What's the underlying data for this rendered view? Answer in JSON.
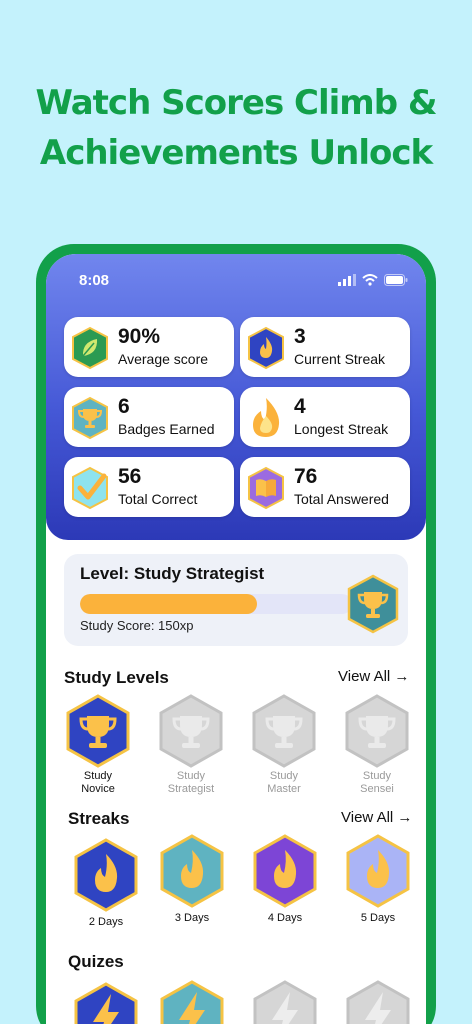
{
  "headline": {
    "line1": "Watch Scores Climb &",
    "line2": "Achievements Unlock"
  },
  "colors": {
    "brand_green": "#12a04a",
    "background": "#c4f2fc",
    "header_top": "#7186ee",
    "header_bottom": "#2c39b7",
    "progress": "#fbb23b"
  },
  "status_bar": {
    "time": "8:08"
  },
  "stats": [
    {
      "value": "90%",
      "label": "Average score",
      "icon": "leaf-icon"
    },
    {
      "value": "3",
      "label": "Current Streak",
      "icon": "flame-icon"
    },
    {
      "value": "6",
      "label": "Badges Earned",
      "icon": "trophy-icon"
    },
    {
      "value": "4",
      "label": "Longest Streak",
      "icon": "flame-icon"
    },
    {
      "value": "56",
      "label": "Total Correct",
      "icon": "checkmark-icon"
    },
    {
      "value": "76",
      "label": "Total Answered",
      "icon": "book-icon"
    }
  ],
  "level": {
    "title": "Level: Study Strategist",
    "score": "Study Score: 150xp",
    "progress": 0.65
  },
  "study_levels": {
    "title": "Study Levels",
    "view_all": "View All →",
    "items": [
      {
        "line1": "Study",
        "line2": "Novice",
        "unlocked": true
      },
      {
        "line1": "Study",
        "line2": "Strategist",
        "unlocked": false
      },
      {
        "line1": "Study",
        "line2": "Master",
        "unlocked": false
      },
      {
        "line1": "Study",
        "line2": "Sensei",
        "unlocked": false
      }
    ]
  },
  "streaks": {
    "title": "Streaks",
    "view_all": "View All →",
    "items": [
      {
        "label": "2 Days",
        "color": "#2f44c2"
      },
      {
        "label": "3 Days",
        "color": "#5fb3c1"
      },
      {
        "label": "4 Days",
        "color": "#7d45d6"
      },
      {
        "label": "5 Days",
        "color": "#aab4f6"
      }
    ]
  },
  "quizzes": {
    "title": "Quizes",
    "items": [
      {
        "color": "#2f44c2",
        "unlocked": true
      },
      {
        "color": "#5fb3c1",
        "unlocked": true
      },
      {
        "color": "#cfcfcf",
        "unlocked": false
      },
      {
        "color": "#cfcfcf",
        "unlocked": false
      }
    ]
  }
}
